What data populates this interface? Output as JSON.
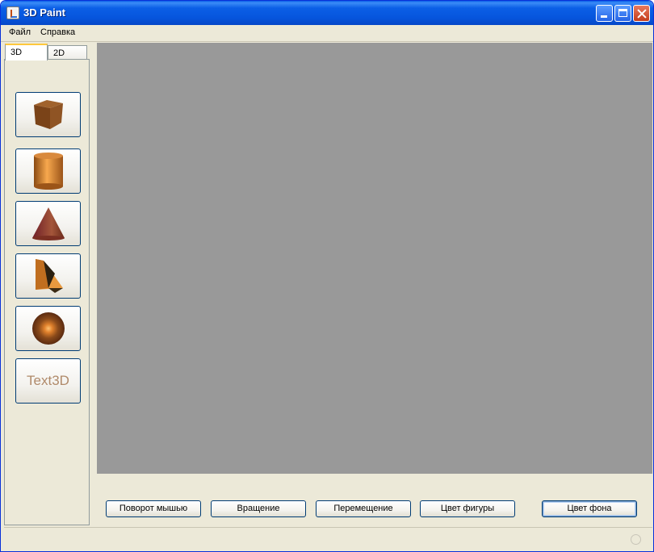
{
  "window": {
    "title": "3D Paint"
  },
  "menu": {
    "items": [
      "Файл",
      "Справка"
    ]
  },
  "tabs": [
    {
      "label": "3D",
      "active": true
    },
    {
      "label": "2D",
      "active": false
    }
  ],
  "tools": [
    {
      "name": "cube-icon"
    },
    {
      "name": "cylinder-icon"
    },
    {
      "name": "cone-icon"
    },
    {
      "name": "prism-icon"
    },
    {
      "name": "sphere-icon"
    },
    {
      "name": "text3d",
      "label": "Text3D"
    }
  ],
  "buttons": {
    "rotate_mouse": "Поворот мышью",
    "rotation": "Вращение",
    "move": "Перемещение",
    "shape_color": "Цвет фигуры",
    "bg_color": "Цвет фона"
  },
  "colors": {
    "canvas": "#999999",
    "title_bar": "#0655dd",
    "shape_accent": "#e18a36"
  }
}
